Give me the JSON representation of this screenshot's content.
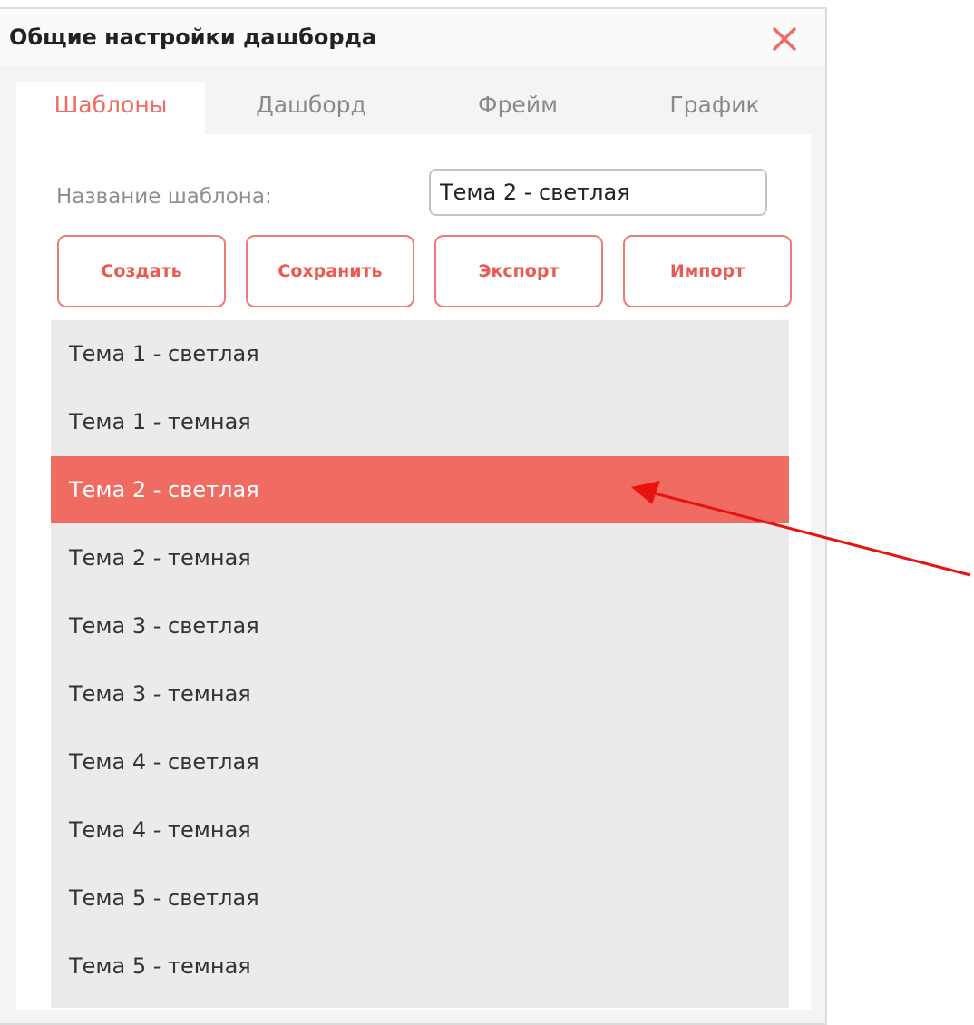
{
  "dialog": {
    "title": "Общие настройки дашборда",
    "close_icon": "close-icon",
    "accent_color": "#ef6b63"
  },
  "tabs": [
    {
      "label": "Шаблоны",
      "active": true
    },
    {
      "label": "Дашборд",
      "active": false
    },
    {
      "label": "Фрейм",
      "active": false
    },
    {
      "label": "График",
      "active": false
    }
  ],
  "template_form": {
    "name_label": "Название шаблона:",
    "name_value": "Тема 2 - светлая"
  },
  "buttons": {
    "create": "Создать",
    "save": "Сохранить",
    "export": "Экспорт",
    "import": "Импорт"
  },
  "themes": [
    {
      "label": "Тема 1 - светлая",
      "selected": false
    },
    {
      "label": "Тема 1 - темная",
      "selected": false
    },
    {
      "label": "Тема 2 - светлая",
      "selected": true
    },
    {
      "label": "Тема 2 - темная",
      "selected": false
    },
    {
      "label": "Тема 3 - светлая",
      "selected": false
    },
    {
      "label": "Тема 3 - темная",
      "selected": false
    },
    {
      "label": "Тема 4 - светлая",
      "selected": false
    },
    {
      "label": "Тема 4 - темная",
      "selected": false
    },
    {
      "label": "Тема 5 - светлая",
      "selected": false
    },
    {
      "label": "Тема 5 - темная",
      "selected": false
    }
  ],
  "annotation": {
    "type": "arrow",
    "color": "#e8130e",
    "points_to": "Тема 2 - светлая"
  }
}
